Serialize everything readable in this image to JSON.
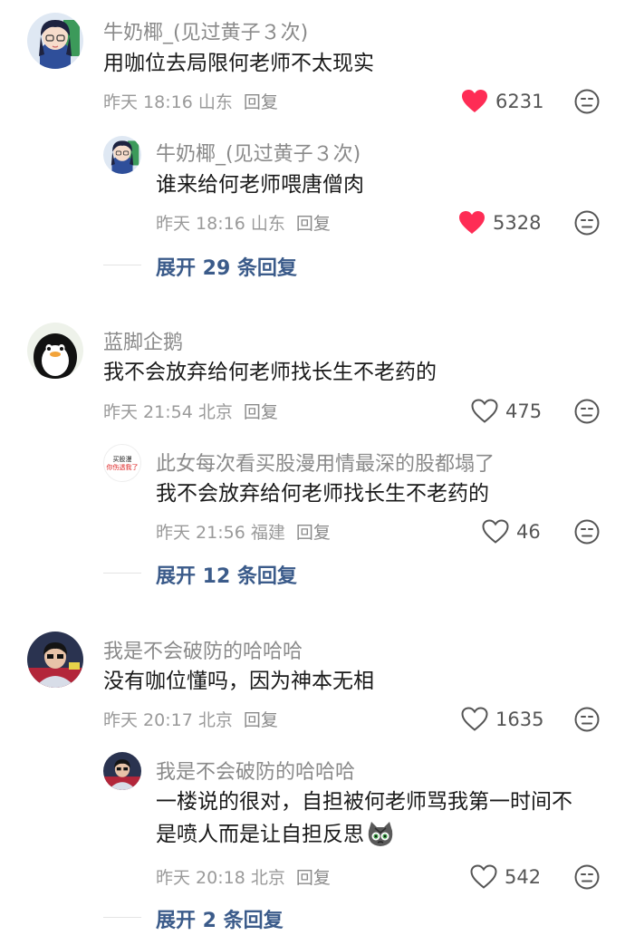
{
  "comments": [
    {
      "author": "牛奶椰_(见过黄子３次)",
      "text": "用咖位去局限何老师不太现实",
      "time": "昨天 18:16",
      "location": "山东",
      "reply_label": "回复",
      "likes": "6231",
      "liked": true,
      "replies": [
        {
          "author": "牛奶椰_(见过黄子３次)",
          "text": "谁来给何老师喂唐僧肉",
          "time": "昨天 18:16",
          "location": "山东",
          "reply_label": "回复",
          "likes": "5328",
          "liked": true
        }
      ],
      "expand_label": "展开 29 条回复"
    },
    {
      "author": "蓝脚企鹅",
      "text": "我不会放弃给何老师找长生不老药的",
      "time": "昨天 21:54",
      "location": "北京",
      "reply_label": "回复",
      "likes": "475",
      "liked": false,
      "replies": [
        {
          "author": "此女每次看买股漫用情最深的股都塌了",
          "text": "我不会放弃给何老师找长生不老药的",
          "time": "昨天 21:56",
          "location": "福建",
          "reply_label": "回复",
          "likes": "46",
          "liked": false,
          "avatar_text": [
            "买股漫",
            "你伤透我了"
          ]
        }
      ],
      "expand_label": "展开 12 条回复"
    },
    {
      "author": "我是不会破防的哈哈哈",
      "text": "没有咖位懂吗，因为神本无相",
      "time": "昨天 20:17",
      "location": "北京",
      "reply_label": "回复",
      "likes": "1635",
      "liked": false,
      "replies": [
        {
          "author": "我是不会破防的哈哈哈",
          "text_line1": "一楼说的很对，自担被何老师骂我第一时间不",
          "text_line2": "是喷人而是让自担反思",
          "time": "昨天 20:18",
          "location": "北京",
          "reply_label": "回复",
          "likes": "542",
          "liked": false
        }
      ],
      "expand_label": "展开 2 条回复"
    }
  ],
  "colors": {
    "like_red": "#fe2c55",
    "expand_blue": "#3b5b8a"
  },
  "icons": [
    "heart-filled-icon",
    "heart-outline-icon",
    "dislike-face-icon",
    "cat-emoji-icon"
  ]
}
